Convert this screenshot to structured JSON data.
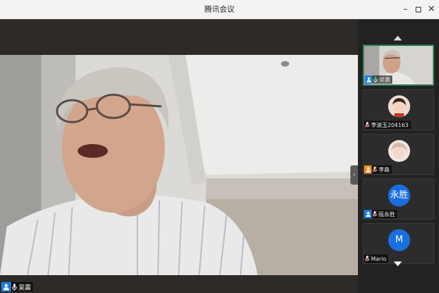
{
  "window": {
    "title": "腾讯会议",
    "controls": {
      "minimize": "–",
      "close": "✕"
    }
  },
  "main_video": {
    "speaker_name": "吴震",
    "collapse_glyph": "›"
  },
  "sidebar": {
    "participants": [
      {
        "name": "吴震",
        "avatar": "video",
        "badge": "host",
        "mic": "active"
      },
      {
        "name": "李淑玉204163",
        "avatar": "photo",
        "badge": "none",
        "mic": "muted"
      },
      {
        "name": "李森",
        "avatar": "photo",
        "badge": "orange",
        "mic": "muted"
      },
      {
        "name": "瓯永胜",
        "avatar": "text",
        "avatar_text": "永胜",
        "badge": "host",
        "mic": "muted"
      },
      {
        "name": "Mario",
        "avatar": "text",
        "avatar_text": "M",
        "badge": "none",
        "mic": "muted"
      }
    ]
  },
  "colors": {
    "accent_blue": "#1e7ee8",
    "active_border": "#2f7f4f",
    "orange_badge": "#f08a1c",
    "mic_active": "#2fd06a",
    "mic_muted": "#e04a4a"
  }
}
